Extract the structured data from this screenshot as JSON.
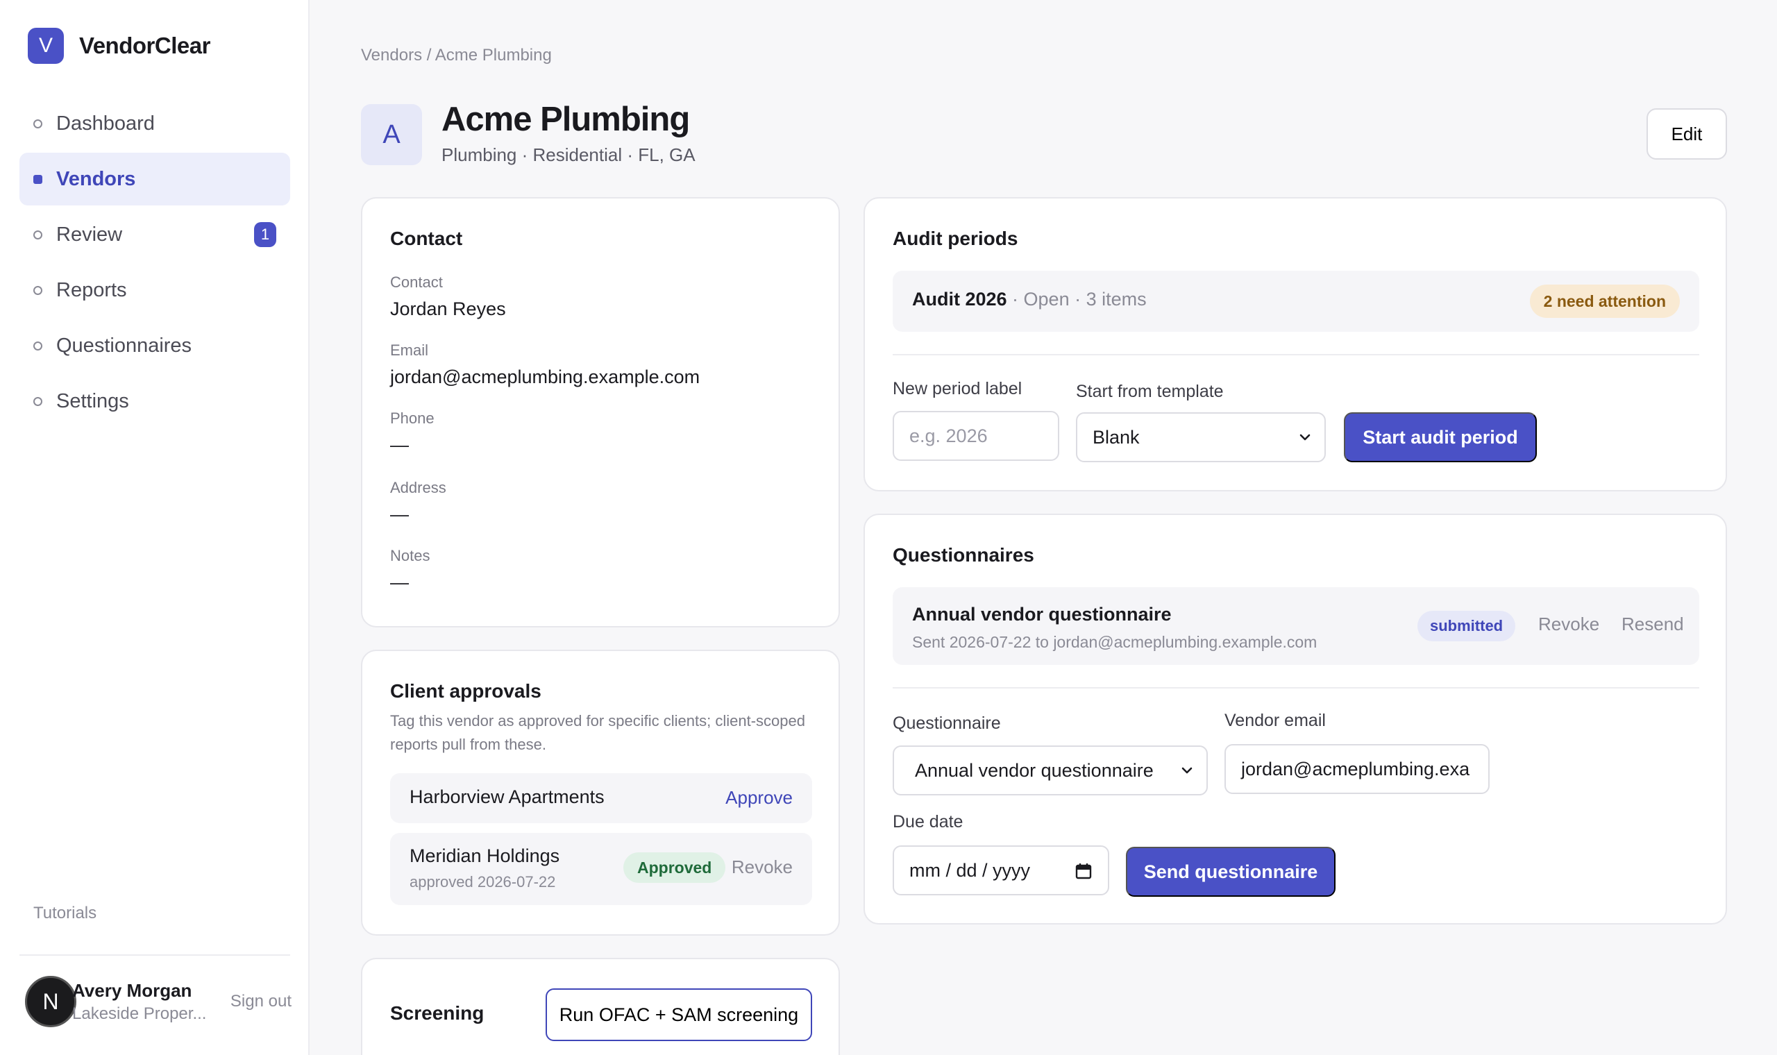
{
  "brand": {
    "logo_letter": "V",
    "name": "VendorClear",
    "accent": "#4a51c6"
  },
  "sidebar": {
    "items": [
      {
        "label": "Dashboard"
      },
      {
        "label": "Vendors",
        "active": true
      },
      {
        "label": "Review",
        "badge": "1"
      },
      {
        "label": "Reports"
      },
      {
        "label": "Questionnaires"
      },
      {
        "label": "Settings"
      }
    ],
    "tutorials": "Tutorials",
    "user": {
      "initial": "N",
      "name": "Avery Morgan",
      "org": "Lakeside Proper...",
      "signout": "Sign out"
    }
  },
  "header": {
    "breadcrumb": "Vendors / Acme Plumbing",
    "avatar_letter": "A",
    "title": "Acme Plumbing",
    "subtitle": "Plumbing · Residential · FL, GA",
    "edit_label": "Edit"
  },
  "contact": {
    "title": "Contact",
    "fields": [
      {
        "label": "Contact",
        "value": "Jordan Reyes"
      },
      {
        "label": "Email",
        "value": "jordan@acmeplumbing.example.com"
      },
      {
        "label": "Phone",
        "value": "—"
      },
      {
        "label": "Address",
        "value": "—"
      },
      {
        "label": "Notes",
        "value": "—"
      }
    ]
  },
  "approvals": {
    "title": "Client approvals",
    "description": "Tag this vendor as approved for specific clients; client-scoped reports pull from these.",
    "rows": [
      {
        "name": "Harborview Apartments",
        "action": "Approve"
      },
      {
        "name": "Meridian Holdings",
        "sub": "approved 2026-07-22",
        "status": "Approved",
        "action": "Revoke"
      }
    ]
  },
  "screening": {
    "title": "Screening",
    "button": "Run OFAC + SAM screening"
  },
  "audit": {
    "title": "Audit periods",
    "period": {
      "name": "Audit 2026",
      "meta": " · Open · 3 items",
      "badge": "2 need attention"
    },
    "new_label": "New period label",
    "new_placeholder": "e.g. 2026",
    "template_label": "Start from template",
    "template_value": "Blank",
    "start_button": "Start audit period"
  },
  "questionnaires": {
    "title": "Questionnaires",
    "item": {
      "name": "Annual vendor questionnaire",
      "sub": "Sent 2026-07-22 to jordan@acmeplumbing.example.com",
      "status": "submitted",
      "revoke": "Revoke",
      "resend": "Resend"
    },
    "questionnaire_label": "Questionnaire",
    "questionnaire_value": "Annual vendor questionnaire",
    "email_label": "Vendor email",
    "email_value": "jordan@acmeplumbing.exa",
    "due_label": "Due date",
    "due_placeholder": "mm / dd / yyyy",
    "send_button": "Send questionnaire"
  }
}
